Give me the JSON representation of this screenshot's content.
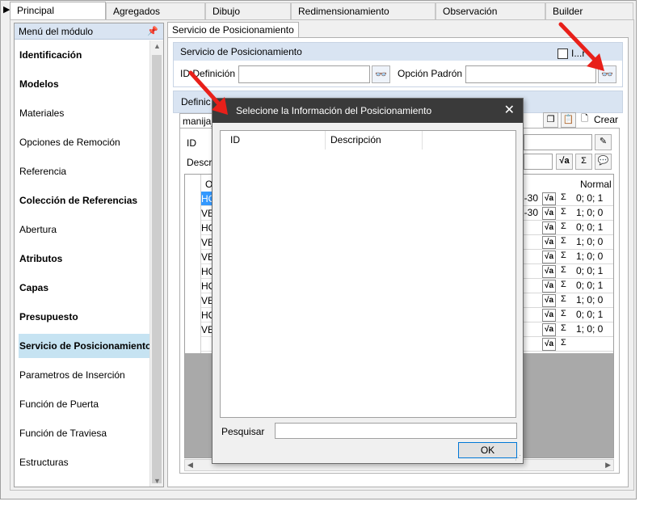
{
  "tabs": [
    "Principal",
    "Agregados",
    "Dibujo",
    "Redimensionamiento",
    "Observación",
    "Builder"
  ],
  "sidebar": {
    "header": "Menú del módulo",
    "items": [
      {
        "label": "Identificación",
        "bold": true
      },
      {
        "label": "Modelos",
        "bold": true
      },
      {
        "label": "Materiales",
        "bold": false
      },
      {
        "label": "Opciones de Remoción",
        "bold": false
      },
      {
        "label": "Referencia",
        "bold": false
      },
      {
        "label": "Colección de Referencias",
        "bold": true
      },
      {
        "label": "Abertura",
        "bold": false
      },
      {
        "label": "Atributos",
        "bold": true
      },
      {
        "label": "Capas",
        "bold": true
      },
      {
        "label": "Presupuesto",
        "bold": true
      },
      {
        "label": "Servicio de Posicionamiento",
        "bold": true,
        "selected": true
      },
      {
        "label": "Parametros de Inserción",
        "bold": false
      },
      {
        "label": "Función de Puerta",
        "bold": false
      },
      {
        "label": "Función de Traviesa",
        "bold": false
      },
      {
        "label": "Estructuras",
        "bold": false
      }
    ]
  },
  "main": {
    "tab": "Servicio de Posicionamiento",
    "group_title": "Servicio de Posicionamiento",
    "checkbox_label": "I...r",
    "id_definicion_label": "ID Definición",
    "opcion_padron_label": "Opción Padrón",
    "group2_title": "Definic",
    "subtab": "manija_",
    "crear_label": "Crear",
    "id_label": "ID",
    "descr_label": "Descr",
    "col_o": "O",
    "col_normal": "Normal",
    "rows": [
      {
        "left": "HO",
        "frag": "2-30",
        "val": "0; 0; 1"
      },
      {
        "left": "VE",
        "frag": "2-30",
        "val": "1; 0; 0"
      },
      {
        "left": "HO",
        "frag": "",
        "val": "0; 0; 1"
      },
      {
        "left": "VE",
        "frag": "",
        "val": "1; 0; 0"
      },
      {
        "left": "VE",
        "frag": "",
        "val": "1; 0; 0"
      },
      {
        "left": "HO",
        "frag": "",
        "val": "0; 0; 1"
      },
      {
        "left": "HO",
        "frag": "",
        "val": "0; 0; 1"
      },
      {
        "left": "VE",
        "frag": "",
        "val": "1; 0; 0"
      },
      {
        "left": "HO",
        "frag": "",
        "val": "0; 0; 1"
      },
      {
        "left": "VE",
        "frag": "",
        "val": "1; 0; 0"
      },
      {
        "left": "",
        "frag": "",
        "val": ""
      }
    ]
  },
  "dialog": {
    "title": "Selecione la Información del Posicionamiento",
    "col_id": "ID",
    "col_desc": "Descripción",
    "search_label": "Pesquisar",
    "ok_label": "OK"
  },
  "colors": {
    "title_bar": "#3a3a3a",
    "header_blue": "#d9e4f2",
    "selected_item": "#c6e3f2",
    "row_selected": "#3399ff",
    "arrow_red": "#e8201a"
  }
}
